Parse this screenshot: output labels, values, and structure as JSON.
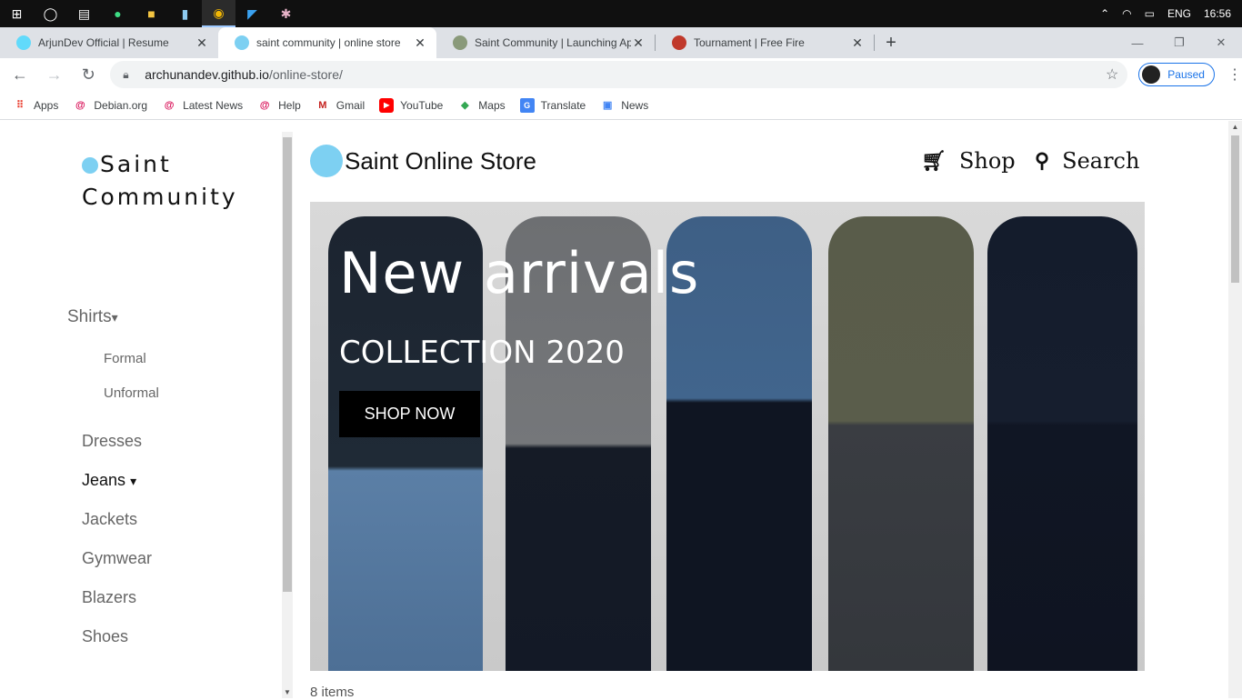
{
  "taskbar": {
    "language": "ENG",
    "time": "16:56"
  },
  "tabs": [
    {
      "title": "ArjunDev Official | Resume",
      "active": false
    },
    {
      "title": "saint community | online store",
      "active": true
    },
    {
      "title": "Saint Community | Launching Ap",
      "active": false
    },
    {
      "title": "Tournament | Free Fire",
      "active": false
    }
  ],
  "toolbar": {
    "url_host": "archunandev.github.io",
    "url_path": "/online-store/",
    "profile_label": "Paused"
  },
  "bookmarks": [
    {
      "label": "Apps",
      "icon": "apps-grid-icon"
    },
    {
      "label": "Debian.org",
      "icon": "debian-icon"
    },
    {
      "label": "Latest News",
      "icon": "debian-icon"
    },
    {
      "label": "Help",
      "icon": "debian-icon"
    },
    {
      "label": "Gmail",
      "icon": "gmail-icon"
    },
    {
      "label": "YouTube",
      "icon": "youtube-icon"
    },
    {
      "label": "Maps",
      "icon": "maps-icon"
    },
    {
      "label": "Translate",
      "icon": "translate-icon"
    },
    {
      "label": "News",
      "icon": "news-icon"
    }
  ],
  "sidebar": {
    "brand_line1": "Saint",
    "brand_line2": "Community",
    "items": [
      {
        "label": "Shirts",
        "caret": "▾"
      },
      {
        "label": "Formal"
      },
      {
        "label": "Unformal"
      },
      {
        "label": "Dresses"
      },
      {
        "label": "Jeans",
        "caret": "▾"
      },
      {
        "label": "Jackets"
      },
      {
        "label": "Gymwear"
      },
      {
        "label": "Blazers"
      },
      {
        "label": "Shoes"
      }
    ]
  },
  "header": {
    "site_title": "Saint Online Store",
    "shop_label": "Shop",
    "search_label": "Search"
  },
  "hero": {
    "title": "New arrivals",
    "subtitle": "COLLECTION 2020",
    "cta": "SHOP NOW"
  },
  "results": {
    "count_text": "8 items"
  },
  "colors": {
    "accent": "#1a73e8",
    "hero_button": "#000000"
  }
}
